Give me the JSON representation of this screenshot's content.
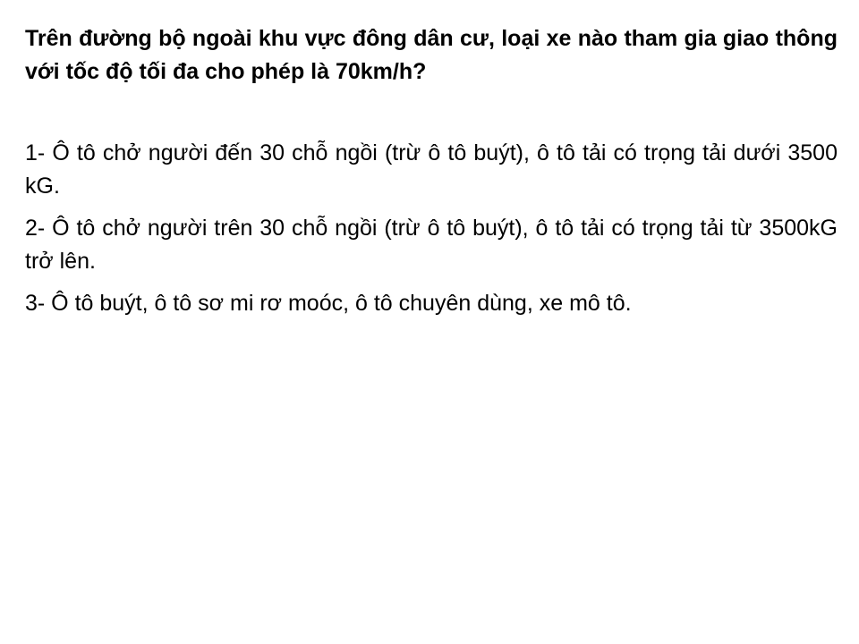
{
  "question": {
    "text": "Trên đường bộ ngoài khu vực đông dân cư, loại xe nào tham gia giao thông với tốc độ tối đa cho phép là 70km/h?"
  },
  "answers": [
    {
      "text": "1- Ô tô chở người đến 30 chỗ ngồi (trừ ô tô buýt), ô tô tải có trọng tải dưới 3500 kG."
    },
    {
      "text": "2- Ô tô chở người trên 30 chỗ ngồi (trừ ô tô buýt), ô tô tải có trọng tải từ 3500kG trở lên."
    },
    {
      "text": "3- Ô tô buýt, ô tô sơ mi rơ moóc, ô tô chuyên dùng, xe mô tô."
    }
  ]
}
